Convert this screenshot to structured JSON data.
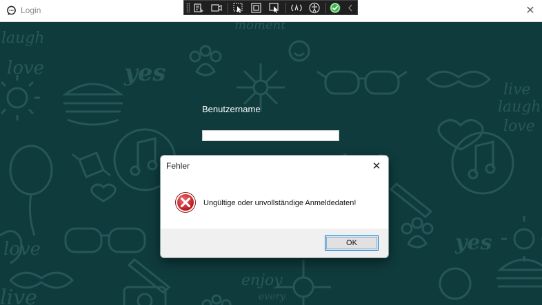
{
  "window": {
    "title": "Login",
    "close_glyph": "✕"
  },
  "devbar": {
    "icons": [
      "live-tree-icon",
      "video-icon",
      "select-element-icon",
      "display-layout-adorners-icon",
      "track-focus-icon",
      "hot-reload-icon",
      "accessibility-icon",
      "check-icon",
      "collapse-icon"
    ]
  },
  "form": {
    "username_label": "Benutzername",
    "username_value": ""
  },
  "dialog": {
    "title": "Fehler",
    "close_glyph": "✕",
    "message": "Ungültige oder unvollständige Anmeldedaten!",
    "ok_label": "OK"
  },
  "background": {
    "doodle_texts": [
      "laugh",
      "love",
      "yes",
      "live",
      "laugh",
      "love",
      "moment",
      "enjoy!",
      "yes",
      "love",
      "live",
      "enjoy",
      "every"
    ]
  },
  "colors": {
    "background": "#0f3b3d",
    "doodle": "#2a5a5b",
    "error_red": "#d0262a",
    "ok_border": "#0078d4",
    "check_green": "#3cb44b"
  }
}
